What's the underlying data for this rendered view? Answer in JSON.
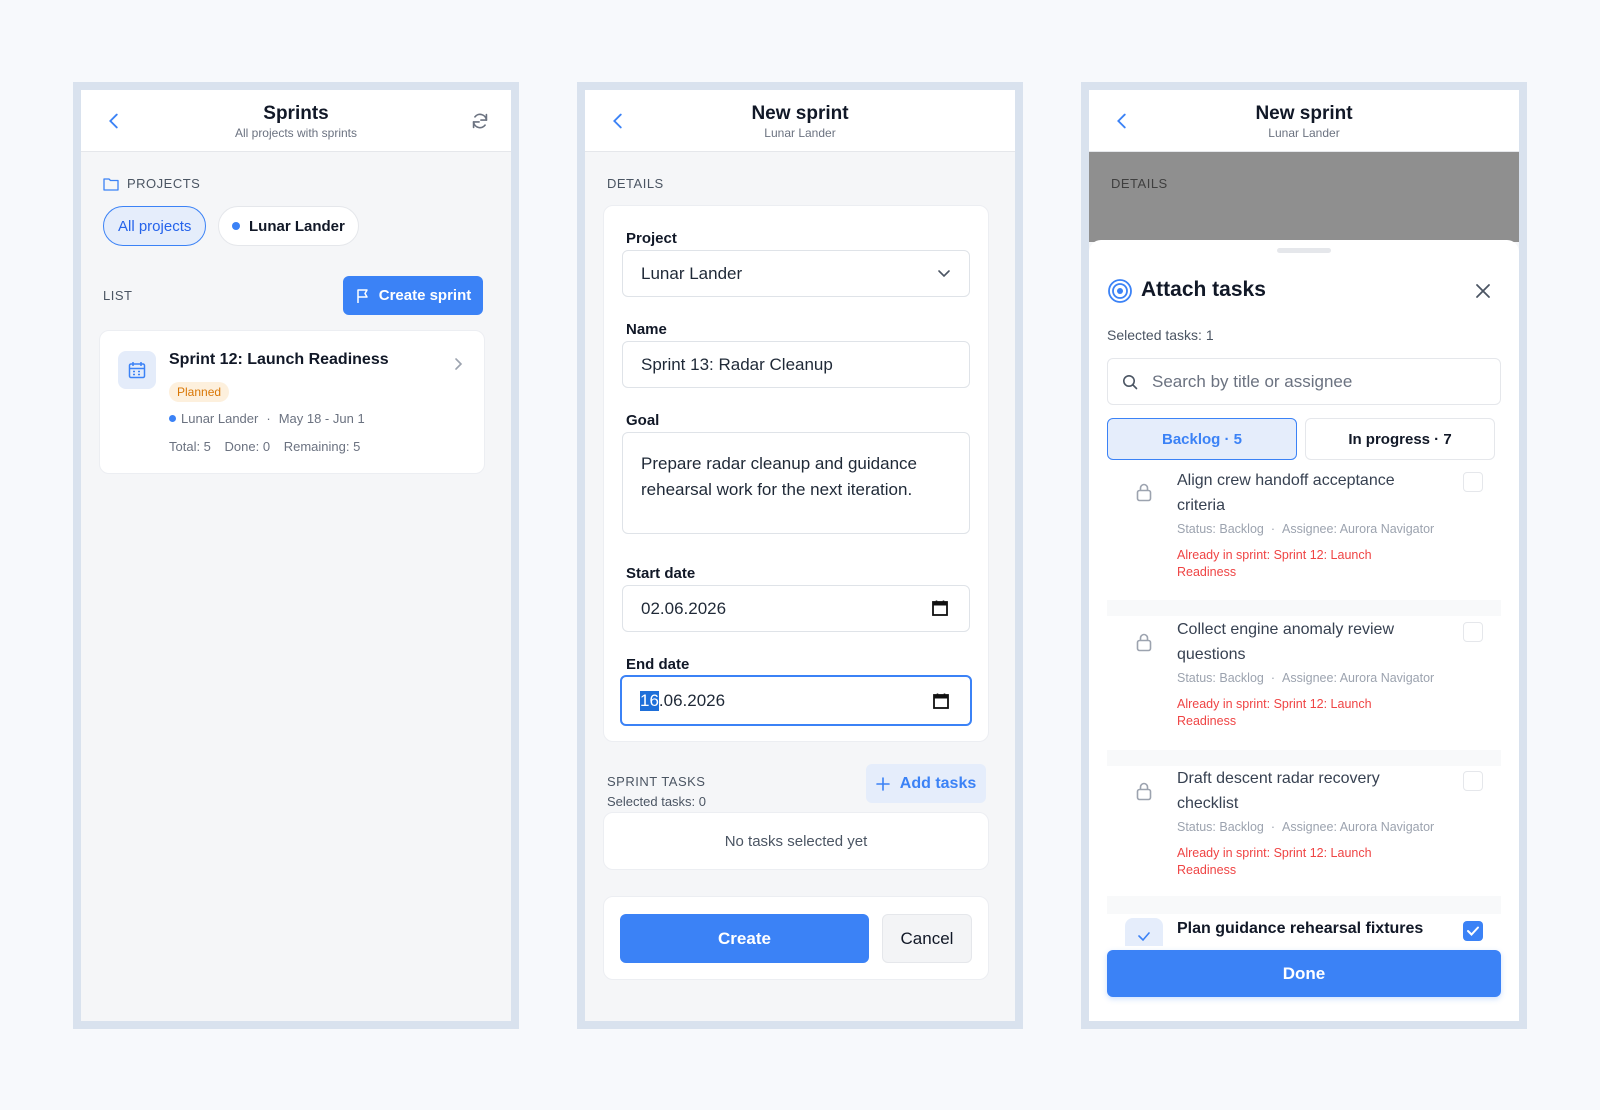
{
  "screen1": {
    "title": "Sprints",
    "subtitle": "All projects with sprints",
    "projects_label": "PROJECTS",
    "chips": [
      "All projects",
      "Lunar Lander"
    ],
    "list_label": "LIST",
    "create_button": "Create sprint",
    "sprint": {
      "name": "Sprint 12: Launch Readiness",
      "badge": "Planned",
      "project": "Lunar Lander",
      "dates": "May 18 - Jun 1",
      "total": "Total: 5",
      "done": "Done: 0",
      "remaining": "Remaining: 5"
    }
  },
  "screen2": {
    "title": "New sprint",
    "subtitle": "Lunar Lander",
    "details_label": "DETAILS",
    "project_label": "Project",
    "project_value": "Lunar Lander",
    "name_label": "Name",
    "name_value": "Sprint 13: Radar Cleanup",
    "goal_label": "Goal",
    "goal_value": "Prepare radar cleanup and guidance rehearsal work for the next iteration.",
    "start_label": "Start date",
    "start_value": "02.06.2026",
    "end_label": "End date",
    "end_value_selected": "16",
    "end_value_rest": ".06.2026",
    "sprint_tasks_label": "SPRINT TASKS",
    "selected_tasks": "Selected tasks: 0",
    "add_tasks": "Add tasks",
    "empty_text": "No tasks selected yet",
    "create_button": "Create",
    "cancel_button": "Cancel"
  },
  "screen3": {
    "title": "New sprint",
    "subtitle": "Lunar Lander",
    "details_label": "DETAILS",
    "sheet_title": "Attach tasks",
    "selected_tasks": "Selected tasks: 1",
    "search_placeholder": "Search by title or assignee",
    "tabs": [
      "Backlog · 5",
      "In progress · 7"
    ],
    "tasks": [
      {
        "title": "Align crew handoff acceptance criteria",
        "status": "Status: Backlog",
        "assignee": "Assignee: Aurora Navigator",
        "warning": "Already in sprint: Sprint 12: Launch Readiness"
      },
      {
        "title": "Collect engine anomaly review questions",
        "status": "Status: Backlog",
        "assignee": "Assignee: Aurora Navigator",
        "warning": "Already in sprint: Sprint 12: Launch Readiness"
      },
      {
        "title": "Draft descent radar recovery checklist",
        "status": "Status: Backlog",
        "assignee": "Assignee: Aurora Navigator",
        "warning": "Already in sprint: Sprint 12: Launch Readiness"
      },
      {
        "title": "Plan guidance rehearsal fixtures"
      }
    ],
    "done_button": "Done"
  },
  "colors": {
    "accent": "#3b82f6",
    "warning": "#ef4444",
    "badge_bg": "#fdf0dd",
    "badge_text": "#d97706"
  }
}
